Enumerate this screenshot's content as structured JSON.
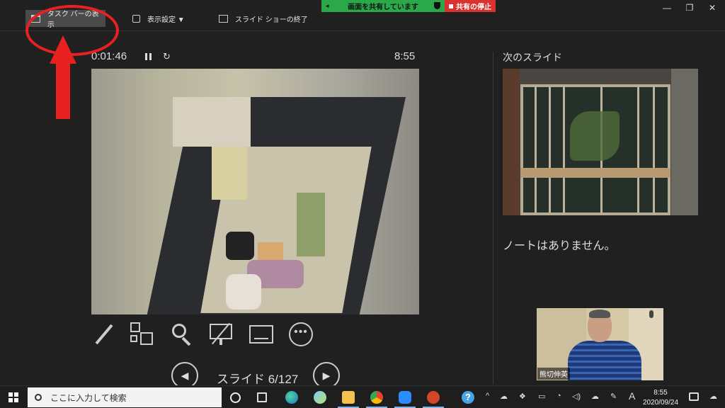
{
  "toolbar": {
    "show_taskbar": "タスク バーの表示",
    "display_settings": "表示設定 ▼",
    "end_show": "スライド ショーの終了"
  },
  "share": {
    "status": "画面を共有しています",
    "stop": "共有の停止",
    "accent": "#2aa84a",
    "stop_color": "#d9322f"
  },
  "window_controls": [
    "—",
    "❐",
    "✕"
  ],
  "timer": {
    "elapsed": "0:01:46",
    "clock": "8:55"
  },
  "navigation": {
    "counter": "スライド 6/127",
    "prev_glyph": "◀",
    "next_glyph": "▶"
  },
  "tools": [
    "pen-icon",
    "see-all-slides-icon",
    "zoom-icon",
    "laser-pointer-icon",
    "subtitles-icon",
    "more-options-icon"
  ],
  "next_pane": {
    "title": "次のスライド",
    "notes": "ノートはありません。"
  },
  "webcam": {
    "participant": "熊切伸英"
  },
  "taskbar": {
    "search_placeholder": "ここに入力して検索",
    "time": "8:55",
    "date": "2020/09/24",
    "ime": "A",
    "help": "?"
  },
  "annotation_color": "#e8201f"
}
